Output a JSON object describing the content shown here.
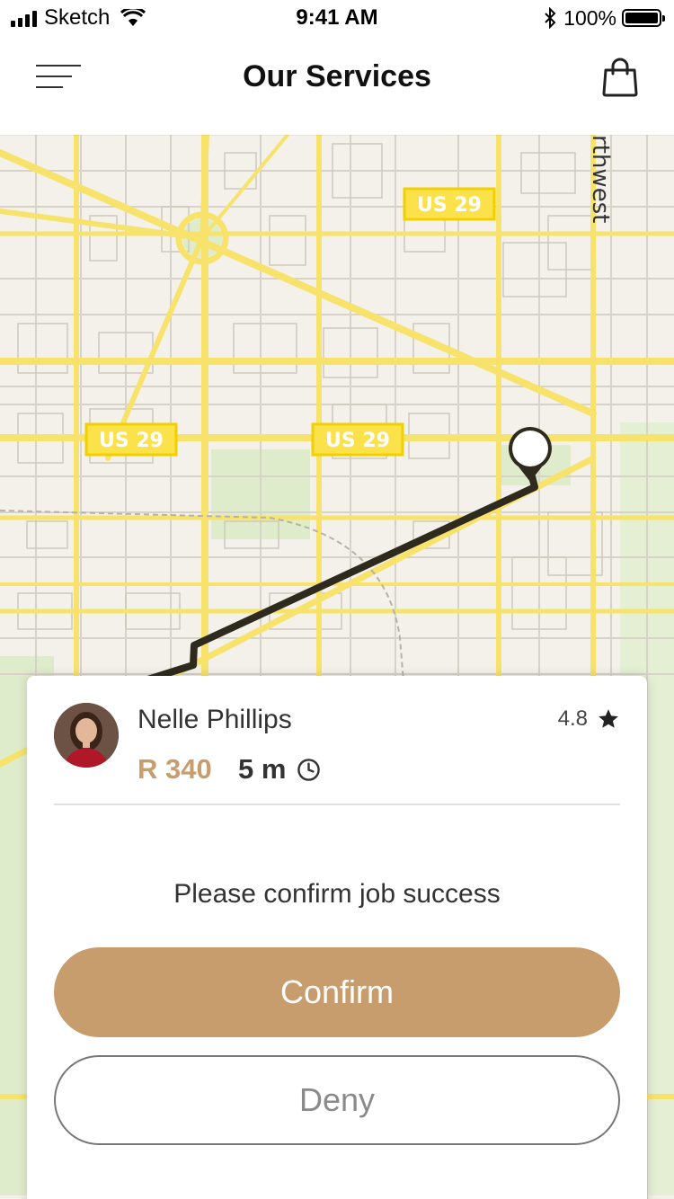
{
  "status_bar": {
    "carrier": "Sketch",
    "time": "9:41 AM",
    "battery": "100%",
    "icons": [
      "signal-icon",
      "wifi-icon",
      "bluetooth-icon",
      "battery-icon"
    ]
  },
  "header": {
    "title": "Our Services",
    "icons": [
      "menu-icon",
      "shopping-bag-icon"
    ]
  },
  "map": {
    "labels": [
      "US 29",
      "US 29",
      "US 29",
      "rthwest"
    ]
  },
  "job_card": {
    "driver_name": "Nelle Phillips",
    "rating": "4.8",
    "price": "R 340",
    "eta": "5 m",
    "prompt": "Please confirm job success",
    "confirm_label": "Confirm",
    "deny_label": "Deny"
  },
  "colors": {
    "accent": "#C89D6E",
    "road_yellow": "#F7E36B",
    "map_background": "#F4F1EA",
    "route": "#2F2A1E"
  }
}
